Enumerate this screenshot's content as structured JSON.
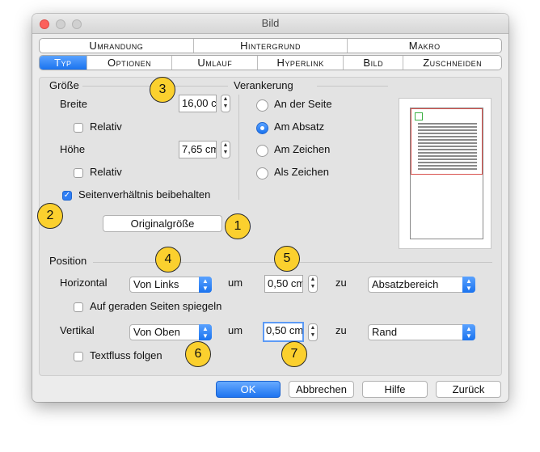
{
  "window": {
    "title": "Bild"
  },
  "tabs_row1": [
    "Umrandung",
    "Hintergrund",
    "Makro"
  ],
  "tabs_row2": [
    "Typ",
    "Optionen",
    "Umlauf",
    "Hyperlink",
    "Bild",
    "Zuschneiden"
  ],
  "active_tab": "Typ",
  "size": {
    "heading": "Größe",
    "width_label": "Breite",
    "width_value": "16,00 c",
    "relative_label": "Relativ",
    "height_label": "Höhe",
    "height_value": "7,65 cm",
    "keep_ratio_label": "Seitenverhältnis beibehalten",
    "keep_ratio_checked": true,
    "original_size_button": "Originalgröße"
  },
  "anchor": {
    "heading": "Verankerung",
    "options": [
      "An der Seite",
      "Am Absatz",
      "Am Zeichen",
      "Als Zeichen"
    ],
    "selected": "Am Absatz"
  },
  "position": {
    "heading": "Position",
    "horizontal_label": "Horizontal",
    "horizontal_select": "Von Links",
    "um_label": "um",
    "horizontal_value": "0,50 cm",
    "zu_label": "zu",
    "horizontal_to": "Absatzbereich",
    "mirror_label": "Auf geraden Seiten spiegeln",
    "vertical_label": "Vertikal",
    "vertical_select": "Von Oben",
    "vertical_value": "0,50 cm",
    "vertical_to": "Rand",
    "follow_text_label": "Textfluss folgen"
  },
  "buttons": {
    "ok": "OK",
    "cancel": "Abbrechen",
    "help": "Hilfe",
    "back": "Zurück"
  },
  "callouts": [
    "1",
    "2",
    "3",
    "4",
    "5",
    "6",
    "7"
  ],
  "colors": {
    "accent": "#1a73ef",
    "callout": "#fbd02e",
    "paragraph_frame": "#d9534f",
    "anchor_marker": "#3cb043"
  },
  "icons": {
    "stepper": "stepper-icon",
    "dropdown": "chevron-updown-icon",
    "check": "checkmark-icon"
  }
}
